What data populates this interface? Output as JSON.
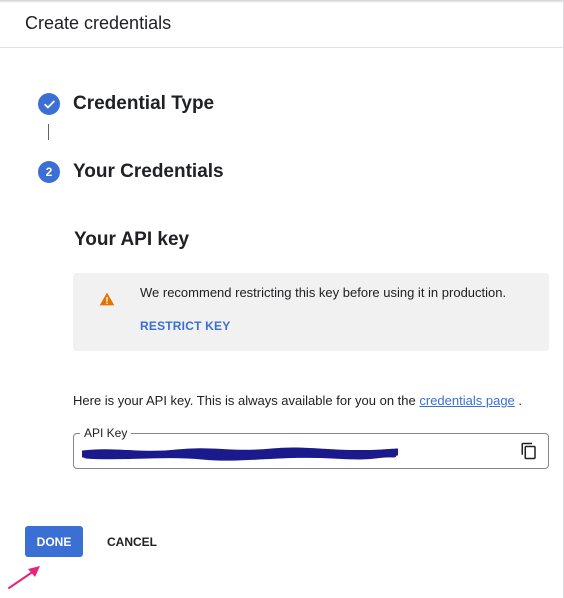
{
  "dialog": {
    "title": "Create credentials"
  },
  "steps": [
    {
      "number": "",
      "title": "Credential Type",
      "status": "complete",
      "icon": "check-icon"
    },
    {
      "number": "2",
      "title": "Your Credentials",
      "status": "active"
    }
  ],
  "api_key_section": {
    "heading": "Your API key",
    "warning": {
      "icon": "warning-icon",
      "text": "We recommend restricting this key before using it in production.",
      "link_label": "RESTRICT KEY"
    },
    "info": {
      "text": "Here is your API key. This is always available for you on the",
      "link_text": "credentials page",
      "suffix": "."
    },
    "key_field": {
      "label": "API Key",
      "copy_icon": "copy-icon"
    }
  },
  "actions": {
    "done_label": "DONE",
    "cancel_label": "CANCEL"
  },
  "colors": {
    "accent": "#3b6fd4",
    "warning": "#e37400",
    "redaction": "#1a1a8c",
    "annotation_arrow": "#e8237a"
  }
}
